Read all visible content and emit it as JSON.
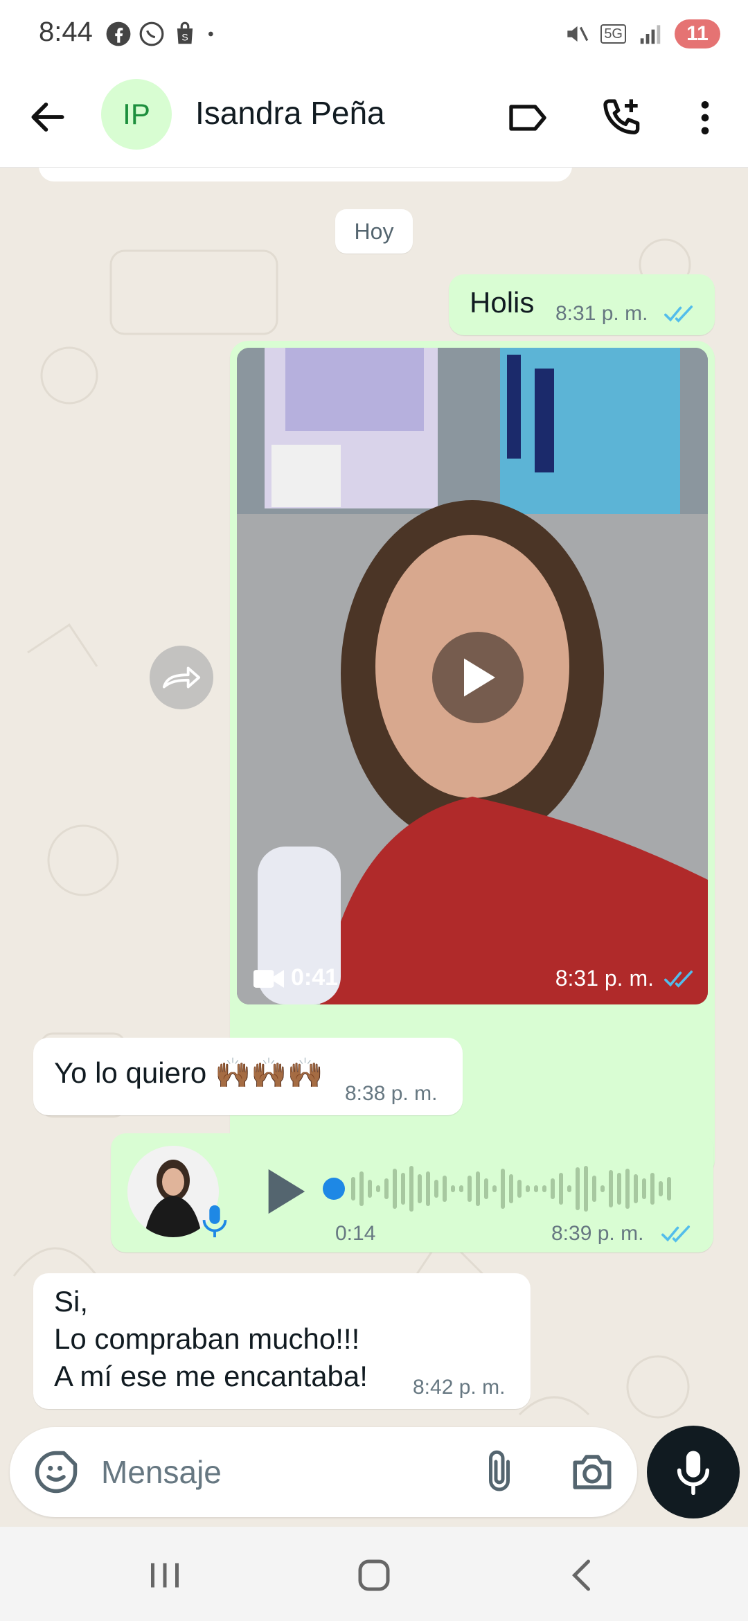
{
  "status_bar": {
    "time": "8:44",
    "battery": "11",
    "network": "5G"
  },
  "header": {
    "avatar_initials": "IP",
    "contact_name": "Isandra Peña"
  },
  "chat": {
    "date_chip": "Hoy",
    "messages": [
      {
        "text": "Holis",
        "time": "8:31 p. m."
      },
      {
        "video_duration": "0:41",
        "time": "8:31 p. m."
      },
      {
        "text": "Yo lo quiero 🙌🏾🙌🏾🙌🏾",
        "time": "8:38 p. m."
      },
      {
        "audio_duration": "0:14",
        "time": "8:39 p. m."
      },
      {
        "lines": [
          "Si,",
          "Lo compraban mucho!!!",
          "A mí ese me encantaba!"
        ],
        "time": "8:42 p. m."
      }
    ]
  },
  "composer": {
    "placeholder": "Mensaje"
  },
  "colors": {
    "outgoing_bubble": "#d9fdd3",
    "incoming_bubble": "#ffffff",
    "chat_bg": "#efeae2",
    "read_ticks": "#53bdeb",
    "avatar_green": "#1d8f3d"
  }
}
